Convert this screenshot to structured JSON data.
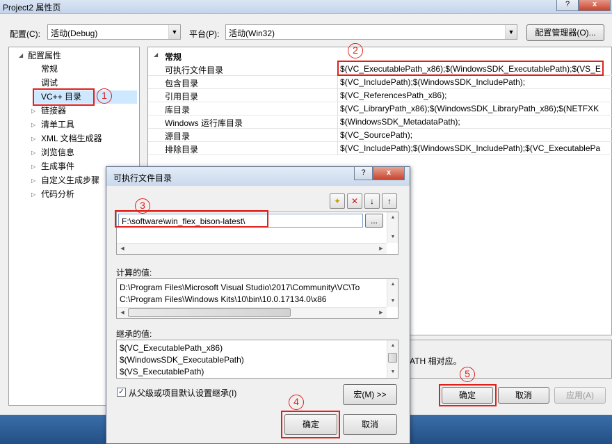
{
  "window": {
    "title": "Project2 属性页",
    "help_glyph": "?",
    "close_glyph": "x"
  },
  "top": {
    "config_label": "配置(C):",
    "config_value": "活动(Debug)",
    "platform_label": "平台(P):",
    "platform_value": "活动(Win32)",
    "config_manager_label": "配置管理器(O)..."
  },
  "tree": {
    "root": "配置属性",
    "children": [
      "常规",
      "调试",
      "VC++ 目录"
    ],
    "groups": [
      "链接器",
      "清单工具",
      "XML 文档生成器",
      "浏览信息",
      "生成事件",
      "自定义生成步骤",
      "代码分析"
    ]
  },
  "grid": {
    "section": "常规",
    "rows": [
      {
        "name": "可执行文件目录",
        "value": "$(VC_ExecutablePath_x86);$(WindowsSDK_ExecutablePath);$(VS_E"
      },
      {
        "name": "包含目录",
        "value": "$(VC_IncludePath);$(WindowsSDK_IncludePath);"
      },
      {
        "name": "引用目录",
        "value": "$(VC_ReferencesPath_x86);"
      },
      {
        "name": "库目录",
        "value": "$(VC_LibraryPath_x86);$(WindowsSDK_LibraryPath_x86);$(NETFXK"
      },
      {
        "name": "Windows 运行库目录",
        "value": "$(WindowsSDK_MetadataPath);"
      },
      {
        "name": "源目录",
        "value": "$(VC_SourcePath);"
      },
      {
        "name": "排除目录",
        "value": "$(VC_IncludePath);$(WindowsSDK_IncludePath);$(VC_ExecutablePa"
      }
    ]
  },
  "description": {
    "text": "ATH 相对应。"
  },
  "bottom_buttons": {
    "ok": "确定",
    "cancel": "取消",
    "apply": "应用(A)"
  },
  "dialog": {
    "title": "可执行文件目录",
    "help_glyph": "?",
    "close_glyph": "x",
    "path_value": "F:\\software\\win_flex_bison-latest\\",
    "browse_label": "...",
    "evaluated_label": "计算的值:",
    "evaluated_lines": [
      "D:\\Program Files\\Microsoft Visual Studio\\2017\\Community\\VC\\To",
      "C:\\Program Files\\Windows Kits\\10\\bin\\10.0.17134.0\\x86"
    ],
    "inherited_label": "继承的值:",
    "inherited_lines": [
      "$(VC_ExecutablePath_x86)",
      "$(WindowsSDK_ExecutablePath)",
      "$(VS_ExecutablePath)"
    ],
    "inherit_checkbox_label": "从父级或项目默认设置继承(I)",
    "inherit_checked": true,
    "macros_label": "宏(M) >>",
    "ok": "确定",
    "cancel": "取消"
  },
  "markers": [
    "1",
    "2",
    "3",
    "4",
    "5"
  ],
  "colors": {
    "annotation": "#e0201a",
    "selection": "#cde8ff",
    "taskbar": "#2c5f9a"
  }
}
